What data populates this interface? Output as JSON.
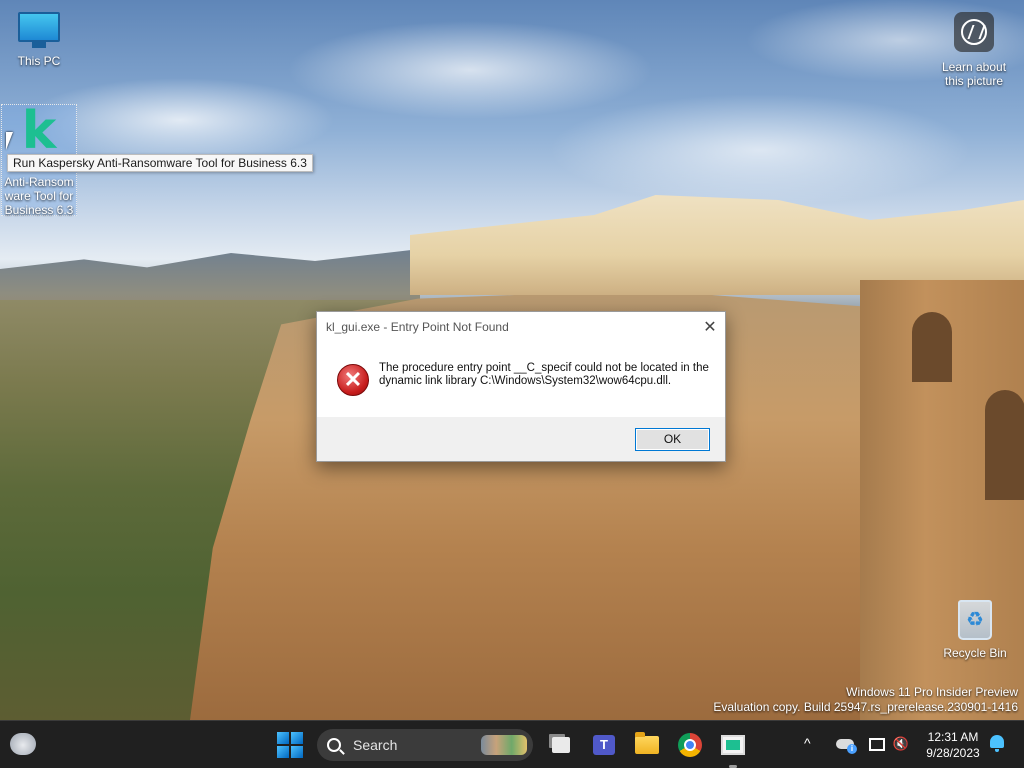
{
  "desktop": {
    "icons": {
      "this_pc": {
        "label": "This PC"
      },
      "kaspersky": {
        "label": "Anti-Ransom ware Tool for Business 6.3",
        "logo_letter": "k"
      },
      "learn": {
        "label": "Learn about this picture"
      },
      "recycle_bin": {
        "label": "Recycle Bin"
      }
    },
    "tooltip": "Run Kaspersky Anti-Ransomware Tool for Business 6.3",
    "watermark": {
      "line1": "Windows 11 Pro Insider Preview",
      "line2": "Evaluation copy. Build 25947.rs_prerelease.230901-1416"
    }
  },
  "dialog": {
    "title": "kl_gui.exe - Entry Point Not Found",
    "close_glyph": "✕",
    "icon": "error-icon",
    "message": "The procedure entry point __C_specif could not be located in the dynamic link library C:\\Windows\\System32\\wow64cpu.dll.",
    "ok_label": "OK"
  },
  "taskbar": {
    "search_placeholder": "Search",
    "clock_time": "12:31 AM",
    "clock_date": "9/28/2023",
    "tray_chevron": "^",
    "colors": {
      "taskbar_bg": "#202020",
      "accent": "#0078d4",
      "error_red": "#c71c1c",
      "kaspersky_green": "#1dbf91"
    }
  }
}
